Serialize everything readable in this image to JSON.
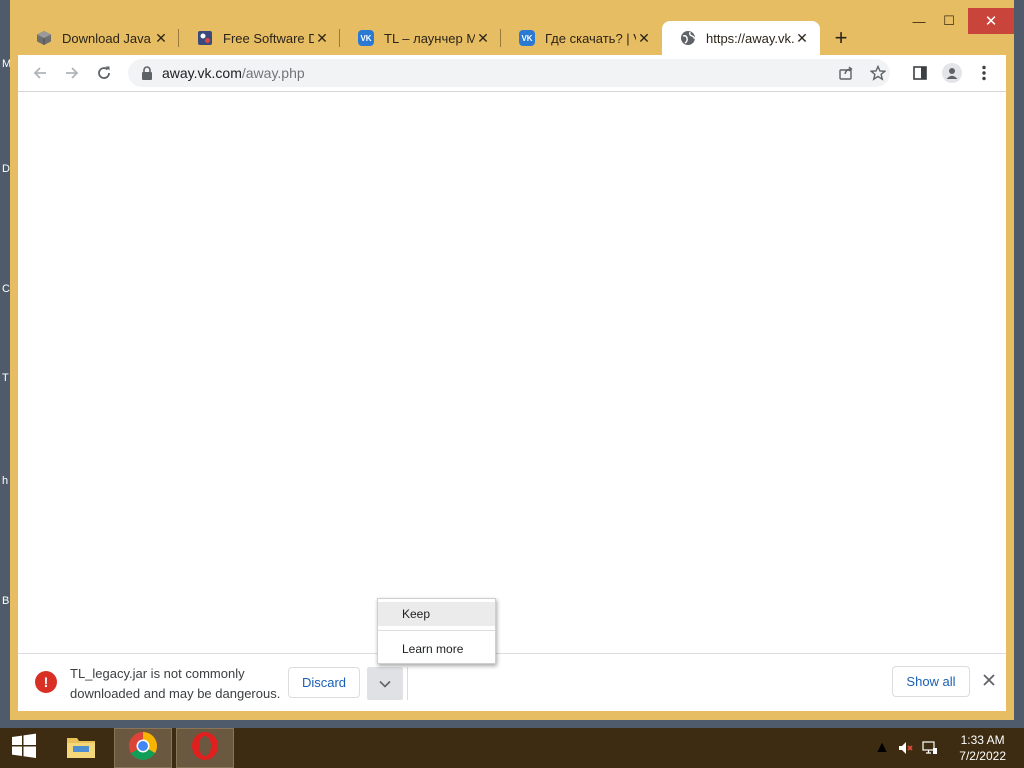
{
  "desktop": {
    "edge_letters": [
      "M",
      "D",
      "C",
      "T",
      "h",
      "B"
    ]
  },
  "window": {
    "controls": {
      "minimize": "—",
      "maximize": "☐",
      "close": "✕"
    },
    "tabs": [
      {
        "title": "Download Java fo",
        "icon": "java-box-icon",
        "close": "✕",
        "active": false
      },
      {
        "title": "Free Software Do",
        "icon": "software-site-icon",
        "close": "✕",
        "active": false
      },
      {
        "title": "TL – лаунчер Min",
        "icon": "vk-icon",
        "close": "✕",
        "active": false
      },
      {
        "title": "Где скачать? | VK",
        "icon": "vk-icon",
        "close": "✕",
        "active": false
      },
      {
        "title": "https://away.vk.co",
        "icon": "globe-icon",
        "close": "✕",
        "active": true
      }
    ],
    "new_tab_label": "+"
  },
  "toolbar": {
    "url_host": "away.vk.com",
    "url_path": "/away.php",
    "icons": [
      "back-icon",
      "forward-icon",
      "reload-icon",
      "lock-icon",
      "share-icon",
      "bookmark-star-icon",
      "side-panel-icon",
      "profile-icon",
      "menu-kebab-icon"
    ]
  },
  "download_shelf": {
    "warning_line1": "TL_legacy.jar is not commonly",
    "warning_line2": "downloaded and may be dangerous.",
    "discard_label": "Discard",
    "show_all_label": "Show all",
    "close_label": "✕"
  },
  "context_menu": {
    "items": [
      {
        "label": "Keep"
      },
      {
        "label": "Learn more"
      }
    ]
  },
  "taskbar": {
    "time": "1:33 AM",
    "date": "7/2/2022",
    "tray_arrow": "▲"
  },
  "colors": {
    "window_frame": "#e6bd62",
    "taskbar": "#3d2c12",
    "link_blue": "#1a5fb4",
    "danger_red": "#d93025"
  }
}
